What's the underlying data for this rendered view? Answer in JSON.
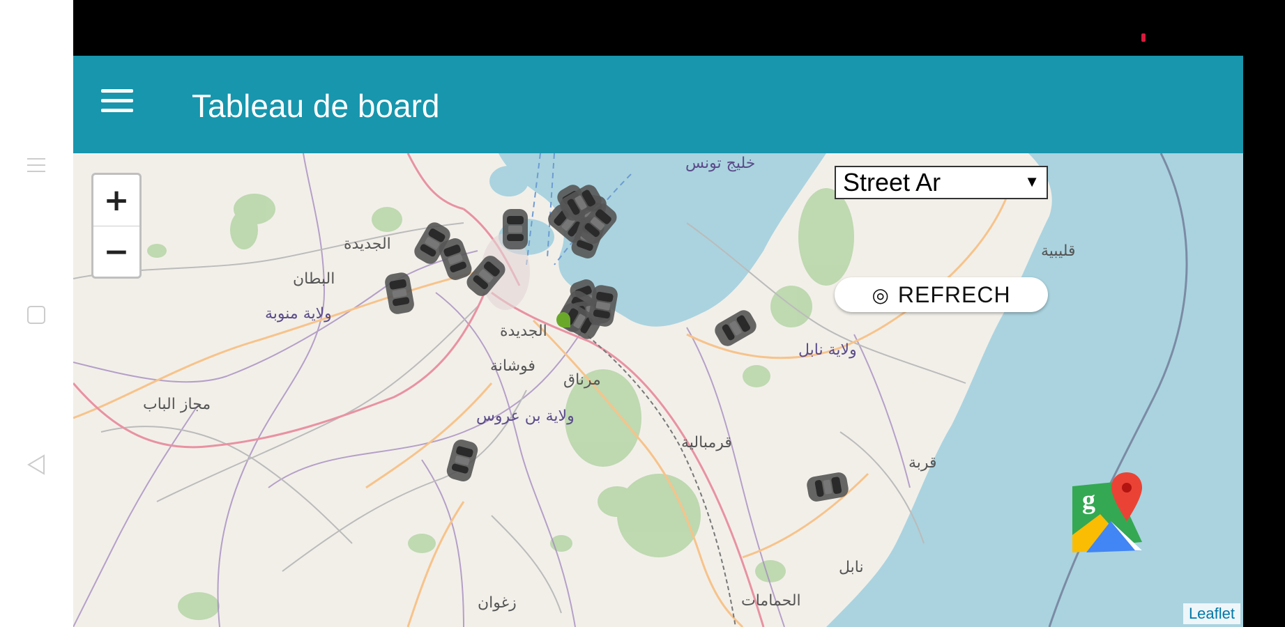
{
  "app": {
    "title": "Tableau de board",
    "menu_icon": "hamburger-menu-icon"
  },
  "android_nav": {
    "icons": [
      "menu-lines-icon",
      "square-icon",
      "back-triangle-icon"
    ]
  },
  "map": {
    "zoom_in_label": "+",
    "zoom_out_label": "−",
    "layer_select": {
      "selected": "Street Ar"
    },
    "refresh_button": {
      "label": "REFRECH",
      "icon": "target-icon"
    },
    "attribution": "Leaflet",
    "place_labels": [
      "خليج تونس",
      "ولاية منوبة",
      "البطان",
      "الجديدة",
      "الجديدة",
      "فوشانة",
      "مرناق",
      "ولاية بن عروس",
      "ولاية نابل",
      "قليبية",
      "قربة",
      "قرمبالية",
      "مجاز الباب",
      "الحمامات",
      "نابل",
      "زغوان"
    ],
    "colors": {
      "water": "#aad3df",
      "land": "#f2efe9",
      "forest": "#add19e",
      "primary_road": "#e892a2",
      "secondary_road": "#f7c38a",
      "boundary": "#a58cbf",
      "car": "#555555"
    },
    "google_maps_icon": "google-maps-icon"
  }
}
